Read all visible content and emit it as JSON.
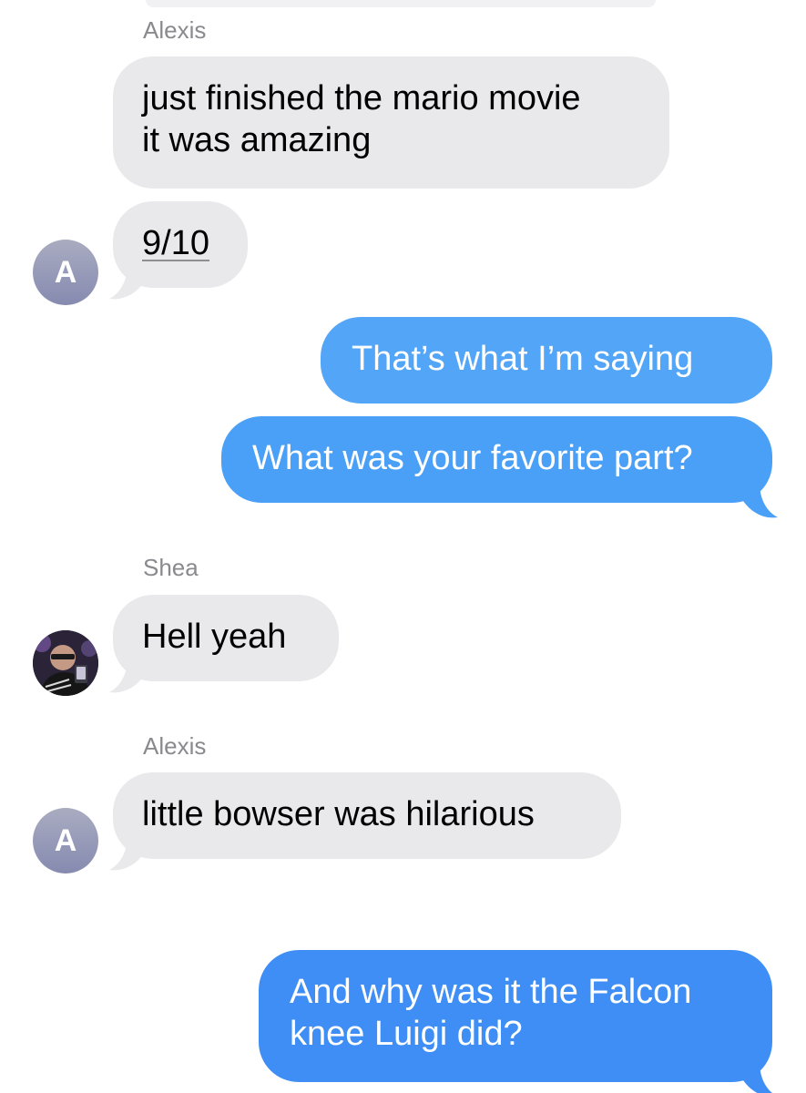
{
  "conversation": {
    "colors": {
      "incoming_bubble": "#e9e9eb",
      "outgoing_bubble": "#3f94f6",
      "outgoing_bubble_light": "#53a5f7",
      "sender_label": "#8a8a8e"
    },
    "group1": {
      "sender": "Alexis",
      "avatar_initial": "A",
      "msg1_line1": "just finished the mario movie",
      "msg1_line2": "it was amazing",
      "msg2": "9/10"
    },
    "outgoing1": {
      "msg1": "That’s what I’m saying",
      "msg2": "What was your favorite part?"
    },
    "group2": {
      "sender": "Shea",
      "avatar_icon": "user-photo-avatar",
      "msg1": "Hell yeah"
    },
    "group3": {
      "sender": "Alexis",
      "avatar_initial": "A",
      "msg1": "little bowser was hilarious"
    },
    "outgoing2": {
      "msg1_line1": "And why was it the Falcon",
      "msg1_line2": "knee Luigi did?"
    }
  }
}
